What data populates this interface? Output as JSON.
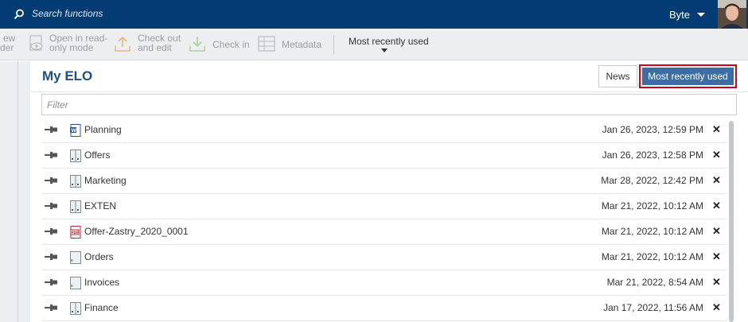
{
  "topbar": {
    "search_placeholder": "Search functions",
    "user_name": "Byte",
    "icons": [
      "search-icon",
      "chevron-down-icon",
      "avatar"
    ]
  },
  "toolbar": {
    "partial_left_line1": "ew",
    "partial_left_line2": "der",
    "open_readonly_line1": "Open in read-",
    "open_readonly_line2": "only mode",
    "checkout_line1": "Check out",
    "checkout_line2": "and edit",
    "checkin": "Check in",
    "metadata": "Metadata",
    "mru_dropdown": "Most recently used"
  },
  "main": {
    "title": "My ELO",
    "tabs": {
      "news": "News",
      "mru": "Most recently used"
    },
    "filter_placeholder": "Filter",
    "rows": [
      {
        "name": "Planning",
        "date": "Jan 26, 2023, 12:59 PM",
        "icon": "word-doc-icon"
      },
      {
        "name": "Offers",
        "date": "Jan 26, 2023, 12:58 PM",
        "icon": "folder-binder-icon"
      },
      {
        "name": "Marketing",
        "date": "Mar 28, 2022, 12:42 PM",
        "icon": "folder-binder-icon"
      },
      {
        "name": "EXTEN",
        "date": "Mar 21, 2022, 10:12 AM",
        "icon": "folder-binder-icon"
      },
      {
        "name": "Offer-Zastry_2020_0001",
        "date": "Mar 21, 2022, 10:12 AM",
        "icon": "pdf-icon"
      },
      {
        "name": "Orders",
        "date": "Mar 21, 2022, 10:12 AM",
        "icon": "folder-icon"
      },
      {
        "name": "Invoices",
        "date": "Mar 21, 2022, 8:54 AM",
        "icon": "folder-icon"
      },
      {
        "name": "Finance",
        "date": "Jan 17, 2022, 11:56 AM",
        "icon": "folder-binder-icon"
      }
    ]
  },
  "colors": {
    "topbar": "#023c72",
    "accent": "#3c6ea5",
    "highlight": "#d0021b"
  }
}
